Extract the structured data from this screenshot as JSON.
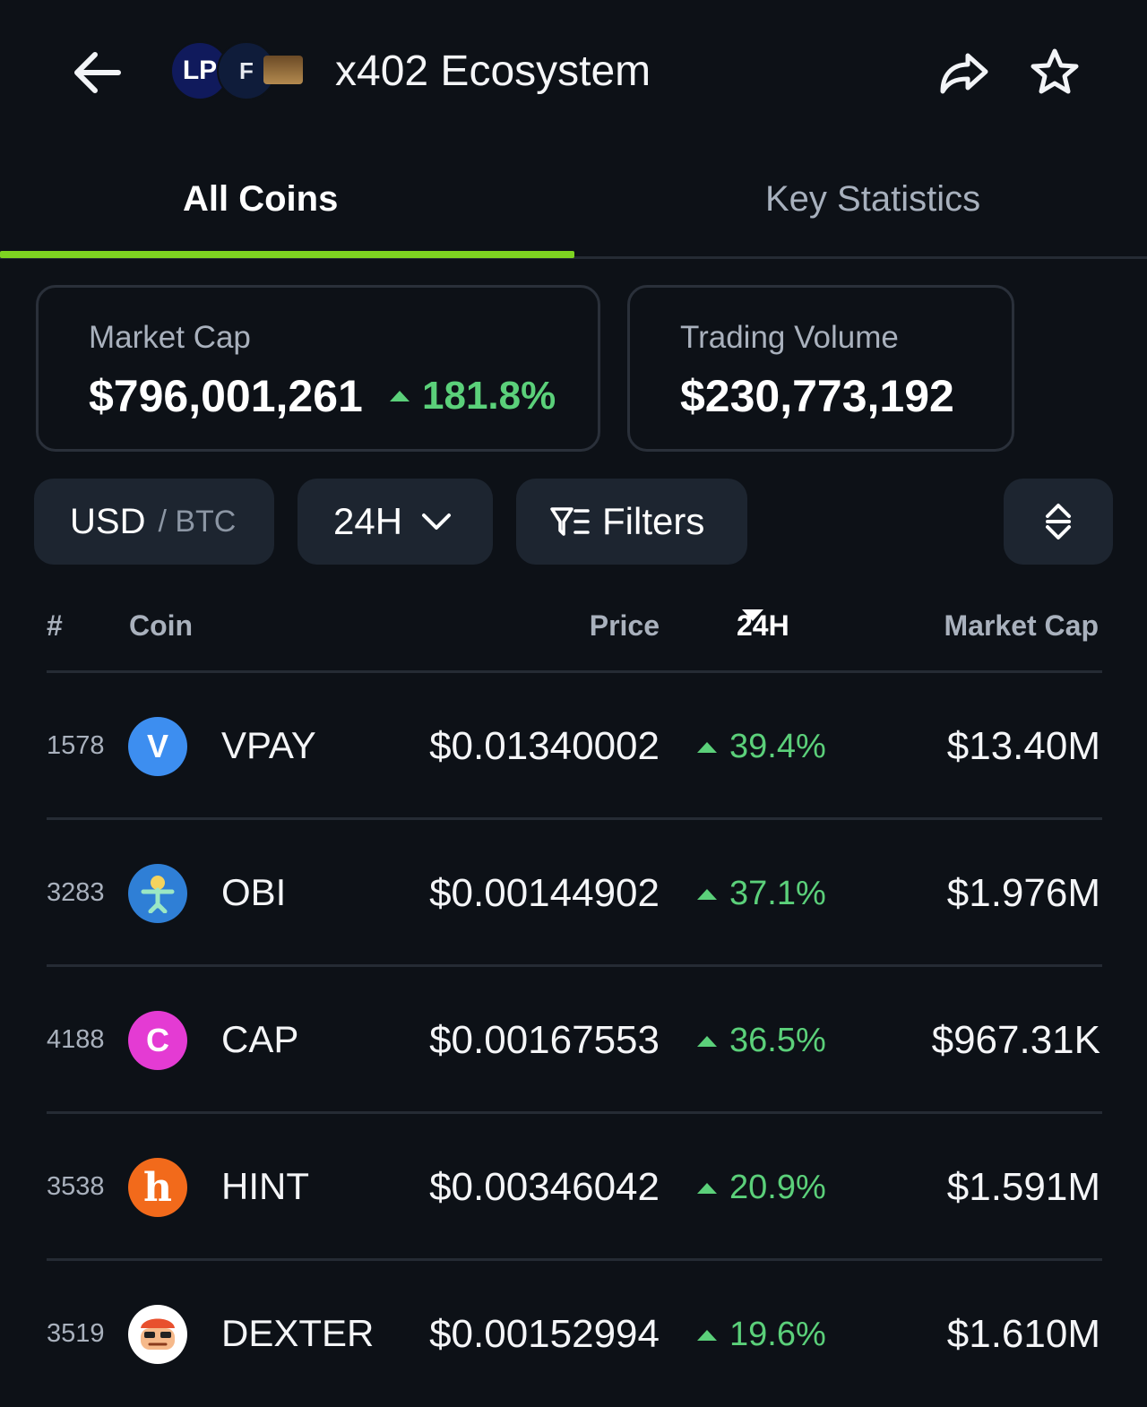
{
  "header": {
    "title": "x402 Ecosystem",
    "logos": [
      "LP",
      "F",
      ""
    ],
    "back_icon": "arrow-left-icon",
    "share_icon": "share-icon",
    "favorite_icon": "star-icon"
  },
  "tabs": [
    {
      "label": "All Coins",
      "active": true
    },
    {
      "label": "Key Statistics",
      "active": false
    }
  ],
  "summary": {
    "market_cap": {
      "label": "Market Cap",
      "value": "$796,001,261",
      "change": "181.8%"
    },
    "trading_volume": {
      "label": "Trading Volume",
      "value": "$230,773,192"
    }
  },
  "controls": {
    "currency_selected": "USD",
    "currency_other": "/ BTC",
    "timeframe": "24H",
    "filters_label": "Filters"
  },
  "table": {
    "headers": {
      "rank": "#",
      "coin": "Coin",
      "price": "Price",
      "change": "24H",
      "market_cap": "Market Cap"
    },
    "rows": [
      {
        "rank": "1578",
        "symbol": "VPAY",
        "price": "$0.01340002",
        "change": "39.4%",
        "market_cap": "$13.40M",
        "icon_letter": "V",
        "icon_color": "#3d8ef0"
      },
      {
        "rank": "3283",
        "symbol": "OBI",
        "price": "$0.00144902",
        "change": "37.1%",
        "market_cap": "$1.976M",
        "icon_letter": "",
        "icon_color": "#2f7fd6"
      },
      {
        "rank": "4188",
        "symbol": "CAP",
        "price": "$0.00167553",
        "change": "36.5%",
        "market_cap": "$967.31K",
        "icon_letter": "C",
        "icon_color": "#e43bd3"
      },
      {
        "rank": "3538",
        "symbol": "HINT",
        "price": "$0.00346042",
        "change": "20.9%",
        "market_cap": "$1.591M",
        "icon_letter": "h",
        "icon_color": "#f26a1b"
      },
      {
        "rank": "3519",
        "symbol": "DEXTER",
        "price": "$0.00152994",
        "change": "19.6%",
        "market_cap": "$1.610M",
        "icon_letter": "",
        "icon_color": "#e8502e"
      }
    ]
  },
  "colors": {
    "background": "#0d1117",
    "accent_green": "#7ed321",
    "positive": "#5bd07a",
    "card_border": "#2a303a",
    "control_bg": "#1d2530"
  }
}
